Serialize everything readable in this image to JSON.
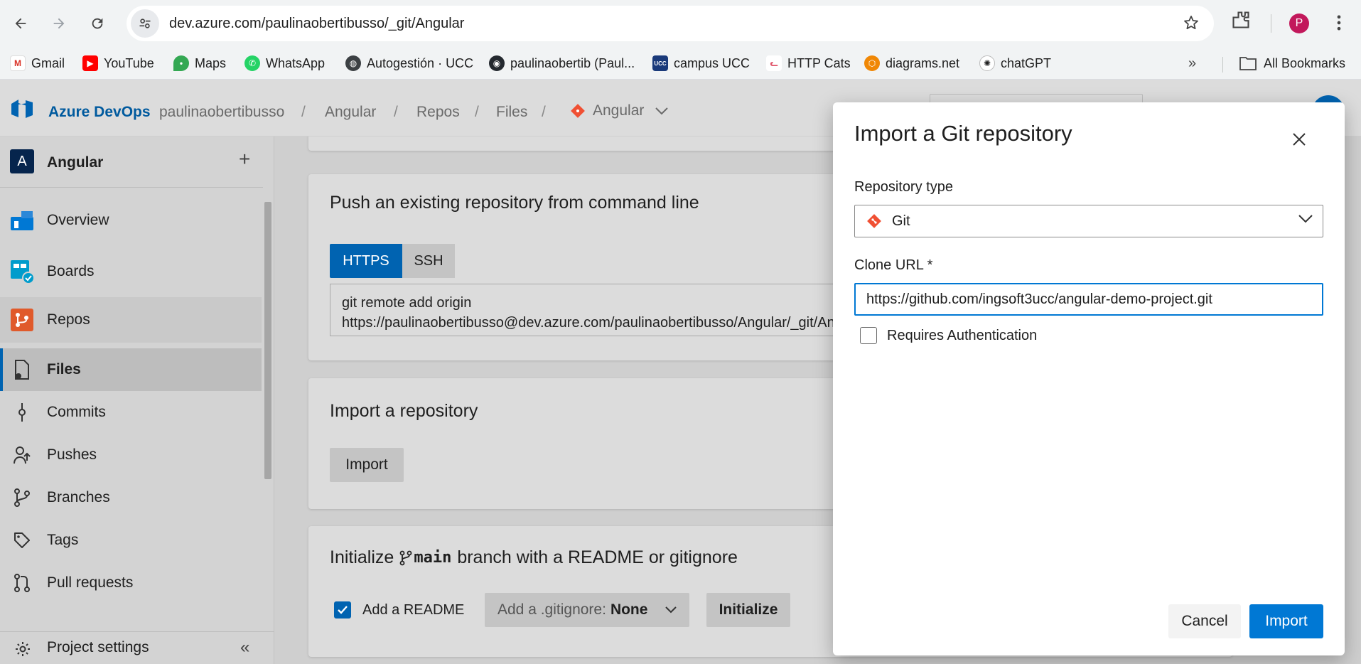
{
  "browser": {
    "url": "dev.azure.com/paulinaobertibusso/_git/Angular",
    "profile_initial": "P",
    "bookmarks": [
      {
        "label": "Gmail",
        "icon": "gmail-icon"
      },
      {
        "label": "YouTube",
        "icon": "youtube-icon"
      },
      {
        "label": "Maps",
        "icon": "maps-icon"
      },
      {
        "label": "WhatsApp",
        "icon": "whatsapp-icon"
      },
      {
        "label": "Autogestión · UCC",
        "icon": "globe-icon"
      },
      {
        "label": "paulinaobertib (Paul...",
        "icon": "github-icon"
      },
      {
        "label": "campus UCC",
        "icon": "ucc-icon"
      },
      {
        "label": "HTTP Cats",
        "icon": "cat-icon"
      },
      {
        "label": "diagrams.net",
        "icon": "diagrams-icon"
      },
      {
        "label": "chatGPT",
        "icon": "chatgpt-icon"
      }
    ],
    "all_bookmarks": "All Bookmarks",
    "more_glyph": "»"
  },
  "header": {
    "brand": "Azure DevOps",
    "breadcrumbs": [
      "paulinaobertibusso",
      "Angular",
      "Repos",
      "Files",
      "Angular"
    ],
    "separator": "/"
  },
  "sidebar": {
    "project_initial": "A",
    "project_name": "Angular",
    "add_glyph": "+",
    "items": [
      {
        "label": "Overview",
        "icon": "overview-icon"
      },
      {
        "label": "Boards",
        "icon": "boards-icon"
      },
      {
        "label": "Repos",
        "icon": "repos-icon"
      },
      {
        "label": "Files",
        "icon": "files-icon"
      },
      {
        "label": "Commits",
        "icon": "commits-icon"
      },
      {
        "label": "Pushes",
        "icon": "pushes-icon"
      },
      {
        "label": "Branches",
        "icon": "branches-icon"
      },
      {
        "label": "Tags",
        "icon": "tags-icon"
      },
      {
        "label": "Pull requests",
        "icon": "pull-requests-icon"
      }
    ],
    "settings_label": "Project settings",
    "collapse_glyph": "«"
  },
  "main": {
    "push_title": "Push an existing repository from command line",
    "tab_https": "HTTPS",
    "tab_ssh": "SSH",
    "cmd_line1": "git remote add origin",
    "cmd_line2": "https://paulinaobertibusso@dev.azure.com/paulinaobertibusso/Angular/_git/Angular",
    "import_title": "Import a repository",
    "import_button": "Import",
    "init_title_prefix": "Initialize",
    "init_branch": "main",
    "init_title_suffix": "branch with a README or gitignore",
    "add_readme": "Add a README",
    "gitignore_prefix": "Add a .gitignore:",
    "gitignore_value": "None",
    "initialize_button": "Initialize"
  },
  "dialog": {
    "title": "Import a Git repository",
    "repo_type_label": "Repository type",
    "repo_type_value": "Git",
    "clone_url_label": "Clone URL *",
    "clone_url_value": "https://github.com/ingsoft3ucc/angular-demo-project.git",
    "requires_auth_label": "Requires Authentication",
    "requires_auth_checked": false,
    "cancel_label": "Cancel",
    "import_label": "Import"
  },
  "colors": {
    "accent": "#0078d4",
    "azure_blue": "#0063b1",
    "git_orange": "#f05033"
  }
}
